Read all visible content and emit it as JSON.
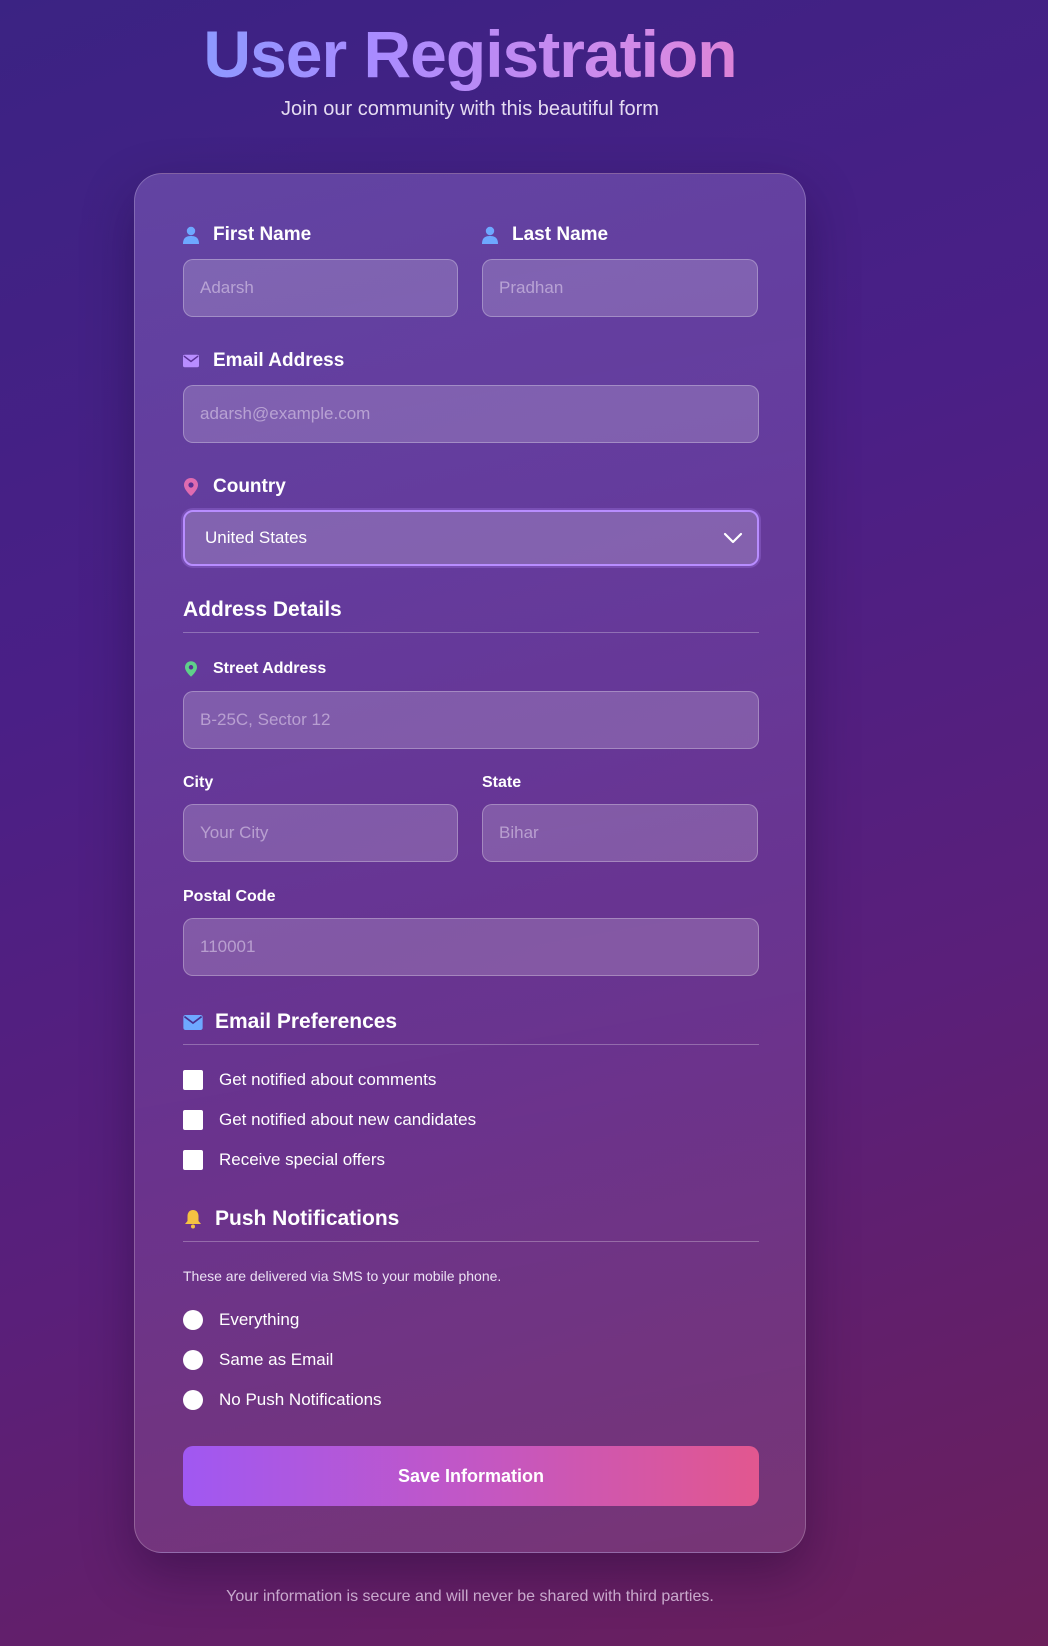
{
  "header": {
    "title": "User Registration",
    "subtitle": "Join our community with this beautiful form"
  },
  "form": {
    "first_name": {
      "label": "First Name",
      "placeholder": "Adarsh",
      "icon": "user-icon"
    },
    "last_name": {
      "label": "Last Name",
      "placeholder": "Pradhan",
      "icon": "user-icon"
    },
    "email": {
      "label": "Email Address",
      "placeholder": "adarsh@example.com",
      "icon": "envelope-icon"
    },
    "country": {
      "label": "Country",
      "value": "United States",
      "icon": "map-pin-icon"
    },
    "address": {
      "title": "Address Details",
      "street": {
        "label": "Street Address",
        "placeholder": "B-25C, Sector 12",
        "icon": "map-pin-icon"
      },
      "city": {
        "label": "City",
        "placeholder": "Your City"
      },
      "state": {
        "label": "State",
        "placeholder": "Bihar"
      },
      "postal": {
        "label": "Postal Code",
        "placeholder": "110001"
      }
    },
    "email_prefs": {
      "title": "Email Preferences",
      "icon": "envelope-icon",
      "options": [
        {
          "label": "Get notified about comments",
          "checked": false
        },
        {
          "label": "Get notified about new candidates",
          "checked": false
        },
        {
          "label": "Receive special offers",
          "checked": false
        }
      ]
    },
    "push": {
      "title": "Push Notifications",
      "icon": "bell-icon",
      "helper": "These are delivered via SMS to your mobile phone.",
      "options": [
        {
          "label": "Everything",
          "selected": false
        },
        {
          "label": "Same as Email",
          "selected": false
        },
        {
          "label": "No Push Notifications",
          "selected": false
        }
      ]
    },
    "save_label": "Save Information"
  },
  "footer": {
    "note": "Your information is secure and will never be shared with third parties."
  },
  "colors": {
    "accent_blue": "#6ea8ff",
    "accent_purple": "#b88dff",
    "accent_pink": "#e2578f",
    "pin_pink": "#e06bb0",
    "pin_green": "#5fd08a",
    "bell_yellow": "#f5c242"
  }
}
